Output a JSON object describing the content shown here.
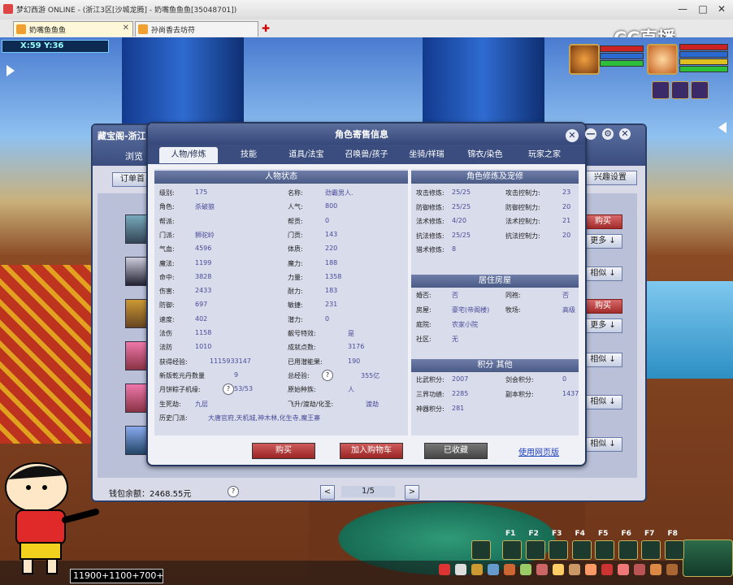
{
  "window": {
    "title": "梦幻西游 ONLINE - (浙江3区[沙城龙腾] - 奶嘴鱼鱼鱼[35048701])",
    "controls": [
      "—",
      "□",
      "✕"
    ]
  },
  "browser_tabs": [
    {
      "label": "奶嘴鱼鱼鱼",
      "active": true
    },
    {
      "label": "孙尚香去坊苻",
      "active": false
    }
  ],
  "watermark": "CC直播",
  "game": {
    "coords": "X:59 Y:36",
    "chat_input": "11900+1100+700+"
  },
  "market_window": {
    "title": "藏宝阁-浙江",
    "tab": "浏览",
    "order_button": "订单首",
    "interest_button": "兴趣设置",
    "buy_label": "购买",
    "more_label": "更多",
    "similar_label": "相似",
    "wallet_label": "钱包余额：",
    "wallet_value": "2468.55元",
    "page": "1/5",
    "prev": "<",
    "next": ">"
  },
  "dialog": {
    "title": "角色寄售信息",
    "tabs": [
      "人物/修炼",
      "技能",
      "道具/法宝",
      "召唤兽/孩子",
      "坐骑/祥瑞",
      "锦衣/染色",
      "玩家之家"
    ],
    "active_tab": 0,
    "status_header": "人物状态",
    "status_left": [
      {
        "label": "级别:",
        "value": "175"
      },
      {
        "label": "角色:",
        "value": "杀破狼"
      },
      {
        "label": "帮派:",
        "value": ""
      },
      {
        "label": "门派:",
        "value": "狮驼岭"
      },
      {
        "label": "气血:",
        "value": "4596"
      },
      {
        "label": "魔法:",
        "value": "1199"
      },
      {
        "label": "命中:",
        "value": "3828"
      },
      {
        "label": "伤害:",
        "value": "2433"
      },
      {
        "label": "防御:",
        "value": "697"
      },
      {
        "label": "速度:",
        "value": "402"
      },
      {
        "label": "法伤",
        "value": "1158"
      },
      {
        "label": "法防",
        "value": "1010"
      },
      {
        "label": "获得经验:",
        "value": "1115933147"
      },
      {
        "label": "新版乾元丹数量",
        "value": "9"
      },
      {
        "label": "月饼粽子机缘:",
        "value": "53/53"
      },
      {
        "label": "生死劫:",
        "value": "九层"
      },
      {
        "label": "历史门派:",
        "value": "大唐官府,天机城,神木林,化生寺,魔王寨"
      }
    ],
    "status_right": [
      {
        "label": "名称:",
        "value": "劲霸男人."
      },
      {
        "label": "人气:",
        "value": "800"
      },
      {
        "label": "帮贡:",
        "value": "0"
      },
      {
        "label": "门贡:",
        "value": "143"
      },
      {
        "label": "体质:",
        "value": "220"
      },
      {
        "label": "魔力:",
        "value": "188"
      },
      {
        "label": "力量:",
        "value": "1358"
      },
      {
        "label": "耐力:",
        "value": "183"
      },
      {
        "label": "敏捷:",
        "value": "231"
      },
      {
        "label": "潜力:",
        "value": "0"
      },
      {
        "label": "靓号特效:",
        "value": "是"
      },
      {
        "label": "成就点数:",
        "value": "3176"
      },
      {
        "label": "已用潜能果:",
        "value": "190"
      },
      {
        "label": "总经验:",
        "value": "355亿"
      },
      {
        "label": "原始种族:",
        "value": "人"
      },
      {
        "label": "飞升/渡劫/化圣:",
        "value": "渡劫"
      }
    ],
    "cultivation_header": "角色修炼及宠修",
    "cultivation": [
      {
        "l1": "攻击修炼:",
        "v1": "25/25",
        "l2": "攻击控制力:",
        "v2": "23"
      },
      {
        "l1": "防御修炼:",
        "v1": "25/25",
        "l2": "防御控制力:",
        "v2": "20"
      },
      {
        "l1": "法术修炼:",
        "v1": "4/20",
        "l2": "法术控制力:",
        "v2": "21"
      },
      {
        "l1": "抗法修炼:",
        "v1": "25/25",
        "l2": "抗法控制力:",
        "v2": "20"
      },
      {
        "l1": "猎术修炼:",
        "v1": "8",
        "l2": "",
        "v2": ""
      }
    ],
    "house_header": "居住房屋",
    "house": [
      {
        "l1": "婚否:",
        "v1": "否",
        "l2": "同袍:",
        "v2": "否"
      },
      {
        "l1": "房屋:",
        "v1": "豪宅(帝阁楼)",
        "l2": "牧场:",
        "v2": "高级"
      },
      {
        "l1": "庭院:",
        "v1": "农家小院",
        "l2": "",
        "v2": ""
      },
      {
        "l1": "社区:",
        "v1": "无",
        "l2": "",
        "v2": ""
      }
    ],
    "points_header": "积分 其他",
    "points": [
      {
        "l1": "比武积分:",
        "v1": "2007",
        "l2": "剑会积分:",
        "v2": "0"
      },
      {
        "l1": "三界功绩:",
        "v1": "2285",
        "l2": "副本积分:",
        "v2": "1437"
      },
      {
        "l1": "神器积分:",
        "v1": "281",
        "l2": "",
        "v2": ""
      }
    ],
    "help_glyph": "?",
    "buttons": {
      "buy": "购买",
      "add_cart": "加入购物车",
      "collected": "已收藏",
      "web_link": "使用网页版"
    }
  },
  "hotkeys": [
    "F1",
    "F2",
    "F3",
    "F4",
    "F5",
    "F6",
    "F7",
    "F8"
  ],
  "colors": {
    "dialog_header": "#35487a",
    "buy_red": "#a22b2b",
    "collected_gray": "#555555",
    "value_text": "#4a4a9a"
  }
}
